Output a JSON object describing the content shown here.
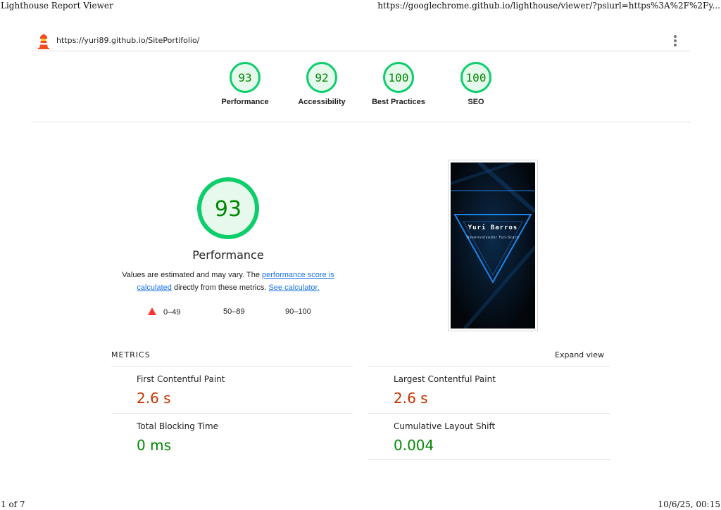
{
  "print_header": {
    "left": "Lighthouse Report Viewer",
    "right": "https://googlechrome.github.io/lighthouse/viewer/?psiurl=https%3A%2F%2Fy..."
  },
  "print_footer": {
    "page": "1 of 7",
    "datetime": "10/6/25, 00:15"
  },
  "topbar": {
    "url": "https://yuri89.github.io/SitePortifolio/",
    "logo_icon": "lighthouse-icon",
    "menu_icon": "vertical-ellipsis-icon"
  },
  "gauges": [
    {
      "label": "Performance",
      "score": "93"
    },
    {
      "label": "Accessibility",
      "score": "92"
    },
    {
      "label": "Best Practices",
      "score": "100"
    },
    {
      "label": "SEO",
      "score": "100"
    }
  ],
  "performance": {
    "score": "93",
    "title": "Performance",
    "desc_part1": "Values are estimated and may vary. The ",
    "desc_link1": "performance score is calculated",
    "desc_part2": " directly from these metrics. ",
    "desc_link2": "See calculator."
  },
  "legend": {
    "fail": "0–49",
    "average": "50–89",
    "pass": "90–100"
  },
  "screenshot": {
    "title": "Yuri Barros",
    "subtitle": "Desenvolvedor Full-Stack"
  },
  "metrics": {
    "heading": "METRICS",
    "expand_label": "Expand view",
    "items": [
      {
        "label": "First Contentful Paint",
        "value": "2.6 s",
        "status": "average"
      },
      {
        "label": "Largest Contentful Paint",
        "value": "2.6 s",
        "status": "average"
      },
      {
        "label": "Total Blocking Time",
        "value": "0 ms",
        "status": "pass"
      },
      {
        "label": "Cumulative Layout Shift",
        "value": "0.004",
        "status": "pass"
      }
    ]
  },
  "colors": {
    "pass": "#0cce6b",
    "pass_text": "#008800",
    "pass_fill": "#e6f9ec",
    "average": "#c33300",
    "fail": "#ff3333",
    "link": "#1a73e8"
  }
}
